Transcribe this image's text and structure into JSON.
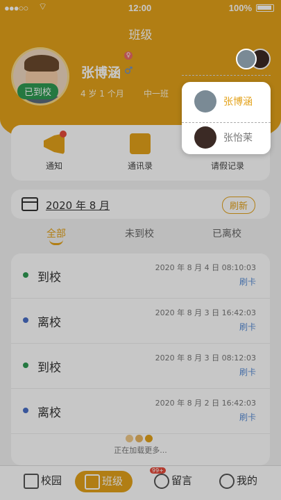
{
  "status_bar": {
    "signal": "●●●○○",
    "time": "12:00",
    "battery": "100%"
  },
  "header": {
    "title": "班级",
    "student_name": "张博涵",
    "age": "4 岁 1 个月",
    "class_name": "中一班",
    "arrival_badge": "已到校"
  },
  "quick_links": [
    {
      "label": "通知",
      "icon": "megaphone-icon"
    },
    {
      "label": "通讯录",
      "icon": "contacts-icon"
    },
    {
      "label": "请假记录",
      "icon": "leave-icon"
    }
  ],
  "date_bar": {
    "date": "2020 年 8 月",
    "refresh": "刷新"
  },
  "tabs": [
    {
      "label": "全部"
    },
    {
      "label": "未到校"
    },
    {
      "label": "已离校"
    }
  ],
  "records": [
    {
      "label": "到校",
      "time": "2020 年 8 月 4 日  08:10:03",
      "method": "刷卡",
      "color": "#2f9a52"
    },
    {
      "label": "离校",
      "time": "2020 年 8 月 3 日  16:42:03",
      "method": "刷卡",
      "color": "#4a6fc7"
    },
    {
      "label": "到校",
      "time": "2020 年 8 月 3 日  08:12:03",
      "method": "刷卡",
      "color": "#2f9a52"
    },
    {
      "label": "离校",
      "time": "2020 年 8 月 2 日  16:42:03",
      "method": "刷卡",
      "color": "#4a6fc7"
    }
  ],
  "loading_text": "正在加载更多...",
  "bottom_nav": [
    {
      "label": "校园"
    },
    {
      "label": "班级"
    },
    {
      "label": "留言",
      "badge": "99+"
    },
    {
      "label": "我的"
    }
  ],
  "child_switcher": [
    {
      "name": "张博涵",
      "selected": true
    },
    {
      "name": "张怡茉",
      "selected": false
    }
  ],
  "colors": {
    "accent": "#e3a21a",
    "arrived": "#2f9a52",
    "left": "#4a6fc7",
    "link": "#5b8fd6"
  }
}
